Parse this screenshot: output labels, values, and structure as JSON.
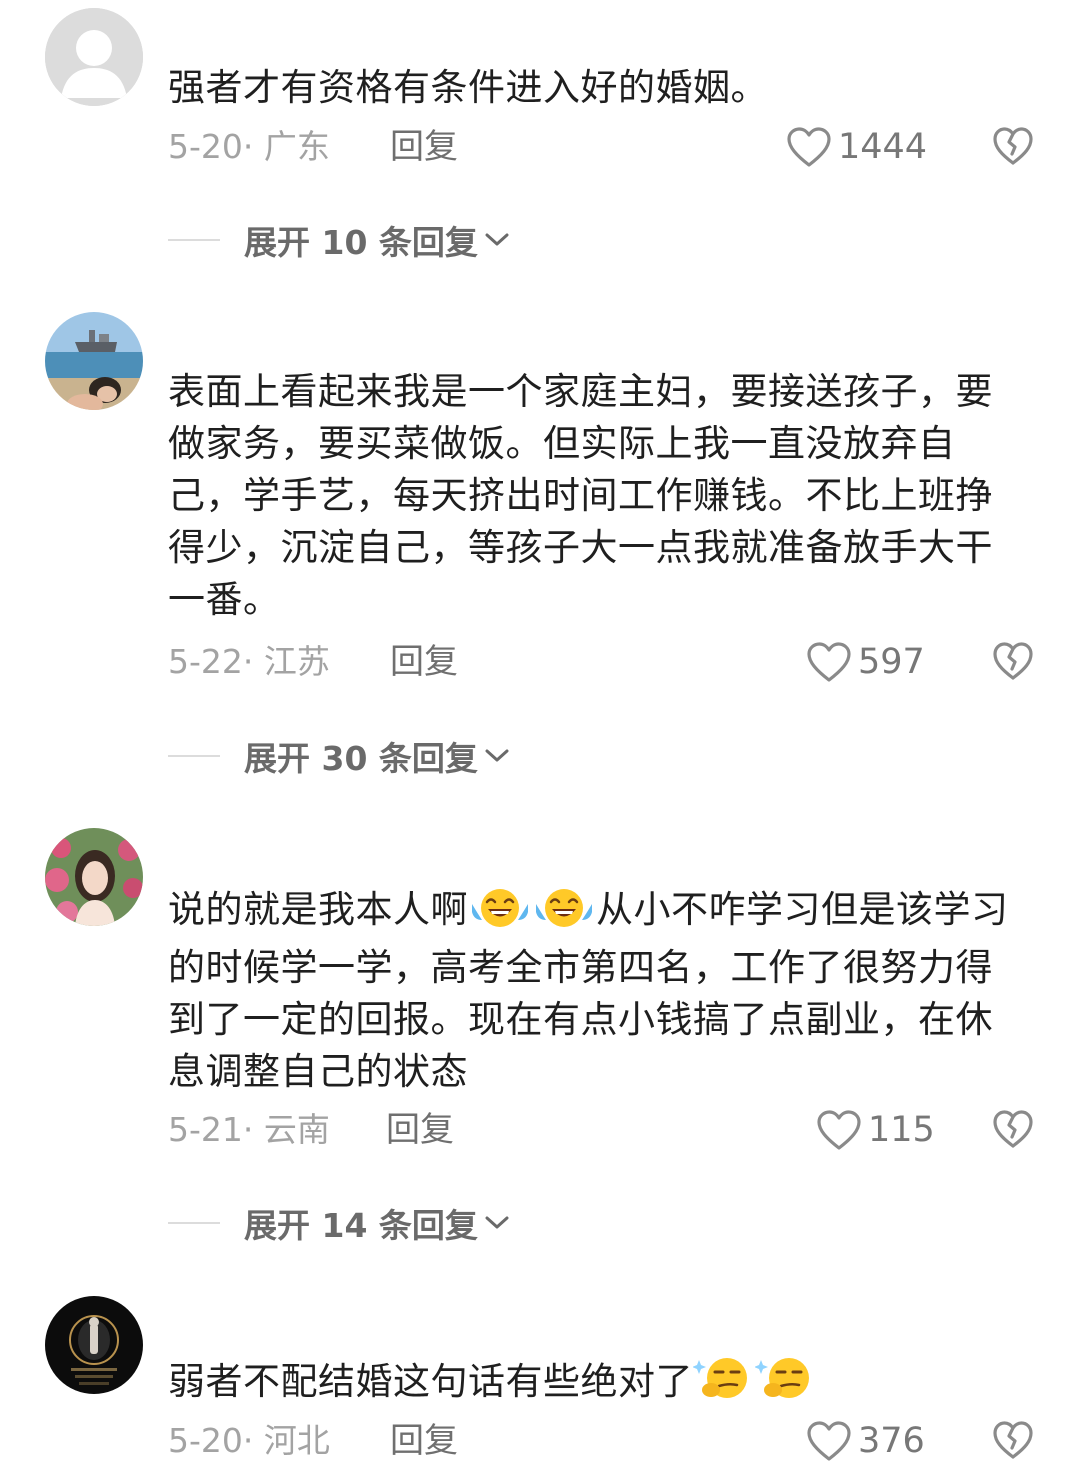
{
  "comments": [
    {
      "text": "强者才有资格有条件进入好的婚姻。",
      "date_location": "5-20· 广东",
      "reply_label": "回复",
      "likes": "1444",
      "expand_label": "展开 10 条回复"
    },
    {
      "text": "表面上看起来我是一个家庭主妇，要接送孩子，要做家务，要买菜做饭。但实际上我一直没放弃自己，学手艺，每天挤出时间工作赚钱。不比上班挣得少，沉淀自己，等孩子大一点我就准备放手大干一番。",
      "date_location": "5-22· 江苏",
      "reply_label": "回复",
      "likes": "597",
      "expand_label": "展开 30 条回复"
    },
    {
      "text_part1": "说的就是我本人啊",
      "text_part2": "从小不咋学习但是该学习的时候学一学，高考全市第四名，工作了很努力得到了一定的回报。现在有点小钱搞了点副业，在休息调整自己的状态",
      "emojis": [
        "laughing-tears-icon",
        "laughing-tears-icon"
      ],
      "date_location": "5-21· 云南",
      "reply_label": "回复",
      "likes": "115",
      "expand_label": "展开 14 条回复"
    },
    {
      "text": "弱者不配结婚这句话有些绝对了",
      "emojis": [
        "smirk-icon",
        "smirk-icon"
      ],
      "date_location": "5-20· 河北",
      "reply_label": "回复",
      "likes": "376"
    }
  ],
  "colors": {
    "text": "#1f1f1f",
    "meta": "#a3a3a3",
    "reply": "#6f6f6f",
    "expand": "#6a6a6a"
  }
}
